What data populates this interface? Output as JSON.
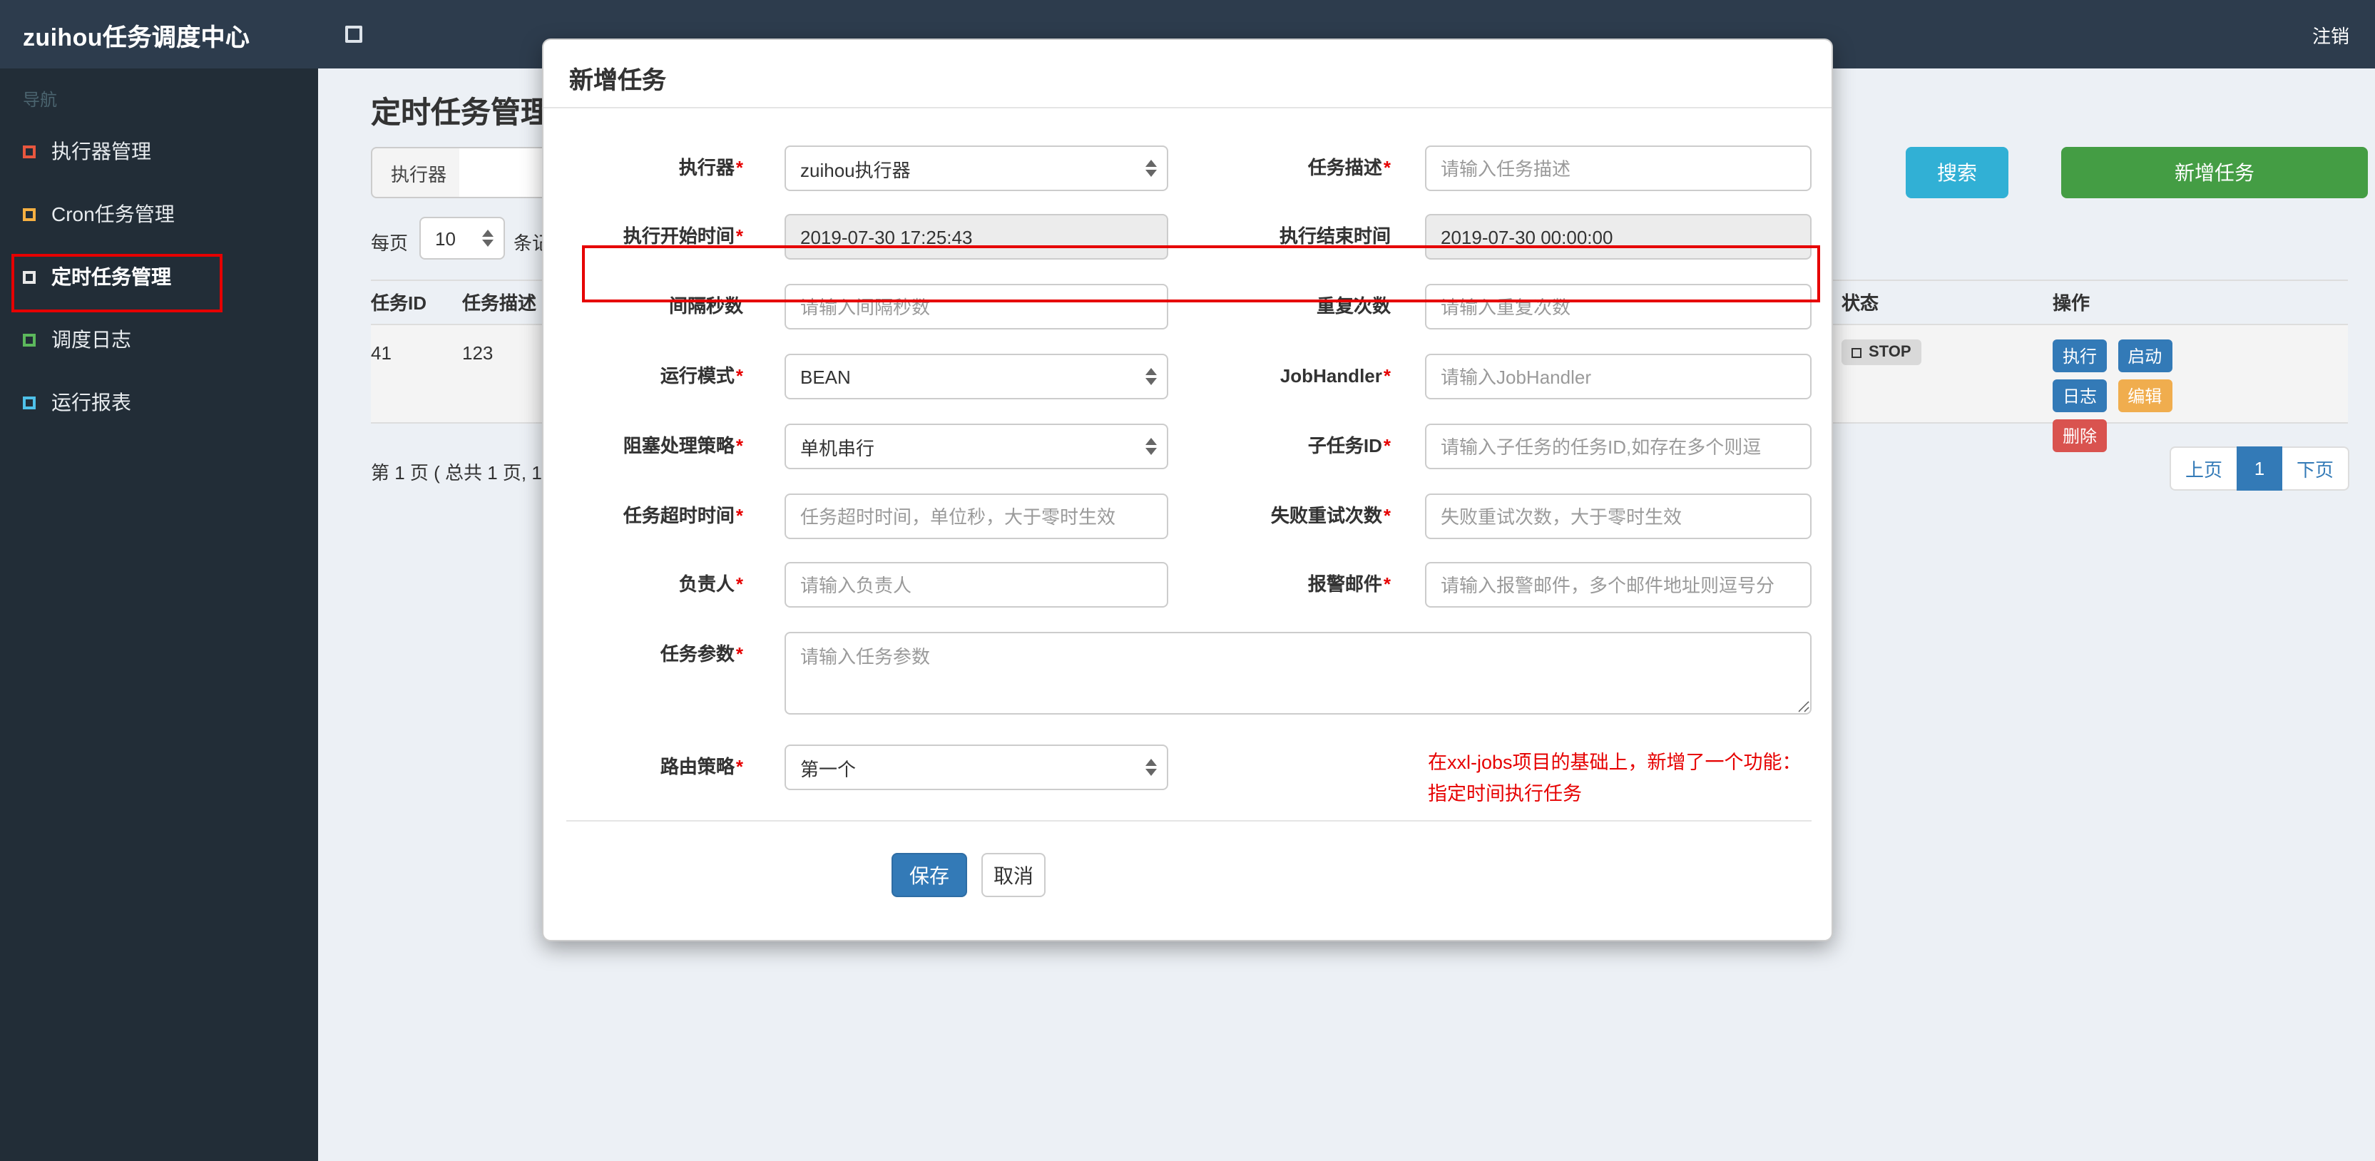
{
  "header": {
    "brand": "zuihou任务调度中心",
    "logout": "注销"
  },
  "sidebar": {
    "section": "导航",
    "items": [
      {
        "label": "执行器管理",
        "icon_style": "border-color:#e9573f"
      },
      {
        "label": "Cron任务管理",
        "icon_style": "border-color:#f6b042"
      },
      {
        "label": "定时任务管理",
        "icon_style": "border-color:#e8e8e8"
      },
      {
        "label": "调度日志",
        "icon_style": "border-color:#5cb85c"
      },
      {
        "label": "运行报表",
        "icon_style": "border-color:#4fc1e9"
      }
    ]
  },
  "page": {
    "title": "定时任务管理",
    "filter": {
      "executor_label": "执行器",
      "search": "搜索",
      "add": "新增任务"
    },
    "perpage": {
      "prefix": "每页",
      "value": "10",
      "suffix": "条记录"
    }
  },
  "table": {
    "headers": {
      "id": "任务ID",
      "desc": "任务描述",
      "status": "状态",
      "op": "操作"
    },
    "row": {
      "id": "41",
      "desc": "123",
      "status": "STOP",
      "actions": {
        "run": "执行",
        "start": "启动",
        "log": "日志",
        "edit": "编辑",
        "del": "删除"
      }
    },
    "pagination": {
      "summary": "第 1 页 ( 总共 1 页, 1",
      "prev": "上页",
      "current": "1",
      "next": "下页"
    }
  },
  "modal": {
    "title": "新增任务",
    "required_mark": "*",
    "fields": {
      "executor": {
        "label": "执行器",
        "value": "zuihou执行器"
      },
      "job_desc": {
        "label": "任务描述",
        "placeholder": "请输入任务描述"
      },
      "start_time": {
        "label": "执行开始时间",
        "value": "2019-07-30 17:25:43"
      },
      "end_time": {
        "label": "执行结束时间",
        "value": "2019-07-30 00:00:00"
      },
      "interval": {
        "label": "间隔秒数",
        "placeholder": "请输入间隔秒数"
      },
      "repeat_count": {
        "label": "重复次数",
        "placeholder": "请输入重复次数"
      },
      "run_mode": {
        "label": "运行模式",
        "value": "BEAN"
      },
      "job_handler": {
        "label": "JobHandler",
        "placeholder": "请输入JobHandler"
      },
      "block_strategy": {
        "label": "阻塞处理策略",
        "value": "单机串行"
      },
      "child_job_id": {
        "label": "子任务ID",
        "placeholder": "请输入子任务的任务ID,如存在多个则逗"
      },
      "timeout": {
        "label": "任务超时时间",
        "placeholder": "任务超时时间，单位秒，大于零时生效"
      },
      "fail_retry": {
        "label": "失败重试次数",
        "placeholder": "失败重试次数，大于零时生效"
      },
      "owner": {
        "label": "负责人",
        "placeholder": "请输入负责人"
      },
      "alarm_email": {
        "label": "报警邮件",
        "placeholder": "请输入报警邮件，多个邮件地址则逗号分"
      },
      "job_param": {
        "label": "任务参数",
        "placeholder": "请输入任务参数"
      },
      "route_strategy": {
        "label": "路由策略",
        "value": "第一个"
      }
    },
    "note": {
      "line1": "在xxl-jobs项目的基础上，新增了一个功能：",
      "line2": "指定时间执行任务"
    },
    "save": "保存",
    "cancel": "取消"
  },
  "colors": {
    "header_bg": "#2d3c4d",
    "sidebar_bg": "#222d37",
    "primary_blue": "#337ab7",
    "search_teal": "#31b0d5",
    "add_green": "#449d44",
    "edit_orange": "#f0ad4e",
    "delete_red": "#d9534f",
    "annotation_red": "#e60000"
  }
}
